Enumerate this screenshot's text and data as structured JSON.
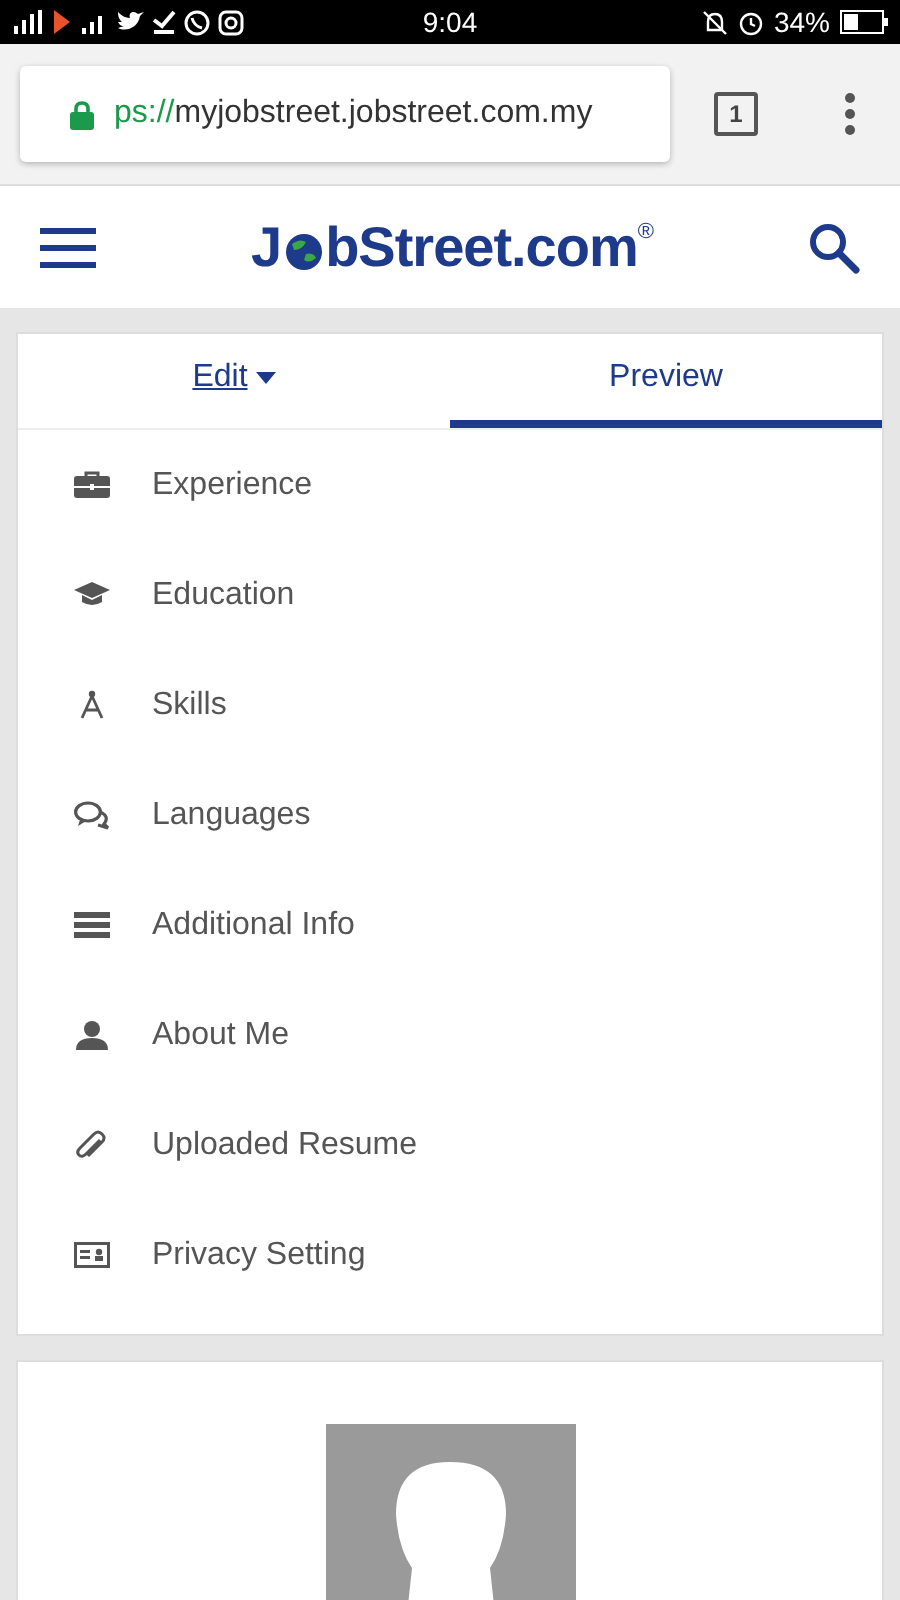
{
  "status_bar": {
    "time": "9:04",
    "battery": "34%"
  },
  "browser": {
    "url_scheme": "ps://",
    "url_host": "myjobstreet.jobstreet.com.my",
    "tab_count": "1"
  },
  "header": {
    "logo": {
      "before": "J",
      "after": "bStreet.com",
      "mark": "®"
    }
  },
  "tabs": [
    {
      "label": "Edit",
      "selected": false,
      "dropdown": true
    },
    {
      "label": "Preview",
      "selected": true,
      "dropdown": false
    }
  ],
  "sections": [
    {
      "kind": "briefcase",
      "label": "Experience"
    },
    {
      "kind": "cap",
      "label": "Education"
    },
    {
      "kind": "compass",
      "label": "Skills"
    },
    {
      "kind": "chat",
      "label": "Languages"
    },
    {
      "kind": "bars",
      "label": "Additional Info"
    },
    {
      "kind": "person",
      "label": "About Me"
    },
    {
      "kind": "clip",
      "label": "Uploaded Resume"
    },
    {
      "kind": "card",
      "label": "Privacy Setting"
    }
  ],
  "profile": {
    "photo": {
      "kind": "placeholder"
    }
  }
}
